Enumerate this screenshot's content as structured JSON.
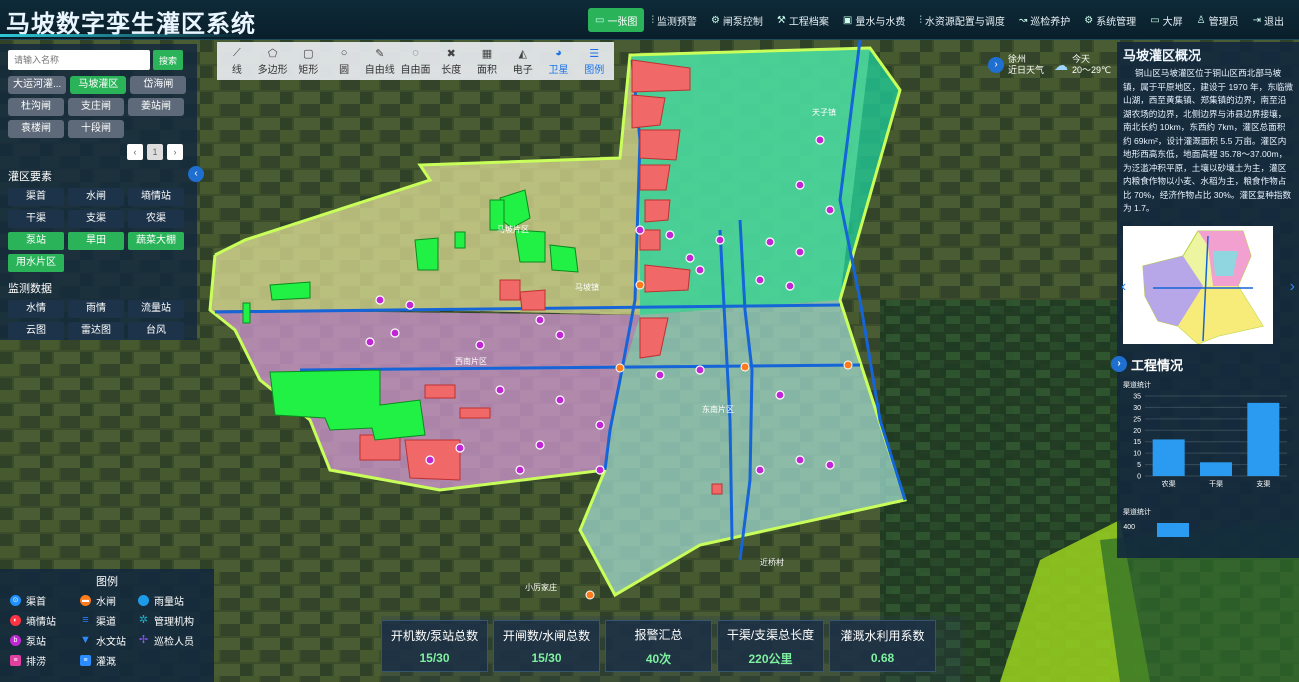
{
  "app": {
    "title": "马坡数字孪生灌区系统"
  },
  "nav": [
    {
      "icon": "screen-icon",
      "label": "一张图",
      "active": true
    },
    {
      "icon": "chart-icon",
      "label": "监测预警"
    },
    {
      "icon": "gear-icon",
      "label": "闸泵控制"
    },
    {
      "icon": "wrench-icon",
      "label": "工程档案"
    },
    {
      "icon": "monitor-icon",
      "label": "量水与水费"
    },
    {
      "icon": "chart-icon",
      "label": "水资源配置与调度"
    },
    {
      "icon": "route-icon",
      "label": "巡检养护"
    },
    {
      "icon": "gear-icon",
      "label": "系统管理"
    },
    {
      "icon": "screen-icon",
      "label": "大屏"
    },
    {
      "icon": "user-icon",
      "label": "管理员"
    },
    {
      "icon": "exit-icon",
      "label": "退出"
    }
  ],
  "search": {
    "placeholder": "请输入名称",
    "button": "搜索"
  },
  "areas": [
    "大运河灌...",
    "马坡灌区",
    "岱海闸",
    "杜沟闸",
    "支庄闸",
    "姜站闸",
    "袁楼闸",
    "十段闸"
  ],
  "pager": [
    "‹",
    "1",
    "›"
  ],
  "elements": {
    "title": "灌区要素",
    "items": [
      "渠首",
      "水闸",
      "墒情站",
      "干渠",
      "支渠",
      "农渠",
      "泵站",
      "旱田",
      "蔬菜大棚",
      "用水片区"
    ]
  },
  "monitor": {
    "title": "监测数据",
    "items": [
      "水情",
      "雨情",
      "流量站",
      "云图",
      "雷达图",
      "台风"
    ]
  },
  "legend": {
    "title": "图例",
    "items": [
      {
        "label": "渠首",
        "color": "#1e90ff"
      },
      {
        "label": "水闸",
        "color": "#ff7a1a"
      },
      {
        "label": "雨量站",
        "color": "#1e9be8"
      },
      {
        "label": "墒情站",
        "color": "#ff3344"
      },
      {
        "label": "渠道",
        "color": "#2a7cff"
      },
      {
        "label": "管理机构",
        "color": "#1ab0c8"
      },
      {
        "label": "泵站",
        "color": "#c026d3"
      },
      {
        "label": "水文站",
        "color": "#2a8cff"
      },
      {
        "label": "巡检人员",
        "color": "#8a55ff"
      },
      {
        "label": "排涝",
        "color": "#e040a0"
      },
      {
        "label": "灌溉",
        "color": "#2a8cff"
      }
    ]
  },
  "tools": [
    {
      "icon": "line-icon",
      "label": "线"
    },
    {
      "icon": "polygon-icon",
      "label": "多边形"
    },
    {
      "icon": "rectangle-icon",
      "label": "矩形"
    },
    {
      "icon": "circle-icon",
      "label": "圆"
    },
    {
      "icon": "freeline-icon",
      "label": "自由线"
    },
    {
      "icon": "freeform-icon",
      "label": "自由面"
    },
    {
      "icon": "ruler-icon",
      "label": "长度"
    },
    {
      "icon": "area-icon",
      "label": "面积"
    },
    {
      "icon": "electronic-map-icon",
      "label": "电子"
    },
    {
      "icon": "satellite-icon",
      "label": "卫星",
      "active": true
    },
    {
      "icon": "legend-icon",
      "label": "图例",
      "active": true
    }
  ],
  "weather": {
    "city": "徐州",
    "sub": "近日天气",
    "day": "今天",
    "range": "20～29℃"
  },
  "overview": {
    "title": "马坡灌区概况",
    "text": "铜山区马坡灌区位于铜山区西北部马坡镇，属于平原地区，建设于 1970 年，东临微山湖，西至黄集镇、郑集镇的边界，南至沿湖农场的边界，北侧边界与沛县边界接壤，南北长约 10km，东西约 7km，灌区总面积约 69km²，设计灌溉面积 5.5 万亩。灌区内地形西高东低，地面高程 35.78～37.00m，为泛滥冲积平原，土壤以砂壤土为主，灌区内粮食作物以小麦、水稻为主，粮食作物占比 70%，经济作物占比 30%。灌区复种指数为 1.7。"
  },
  "engineering": {
    "title": "工程情况",
    "chart_caption": "渠道统计",
    "chart_caption2": "渠道统计",
    "second_top_tick": "400"
  },
  "chart_data": {
    "type": "bar",
    "title": "渠道统计",
    "categories": [
      "农渠",
      "干渠",
      "支渠"
    ],
    "values": [
      16,
      6,
      32
    ],
    "ylim": [
      0,
      35
    ],
    "yticks": [
      0,
      5,
      10,
      15,
      20,
      25,
      30,
      35
    ],
    "color": "#2a9bf0",
    "grid": true
  },
  "stats": [
    {
      "label": "开机数/泵站总数",
      "value": "15/30"
    },
    {
      "label": "开闸数/水闸总数",
      "value": "15/30"
    },
    {
      "label": "报警汇总",
      "value": "40次"
    },
    {
      "label": "干渠/支渠总长度",
      "value": "220公里"
    },
    {
      "label": "灌溉水利用系数",
      "value": "0.68"
    }
  ],
  "map_labels": [
    "马坡片区",
    "西南片区",
    "东南片区",
    "天子镇",
    "马坡镇",
    "近桥村",
    "小厉家庄"
  ]
}
